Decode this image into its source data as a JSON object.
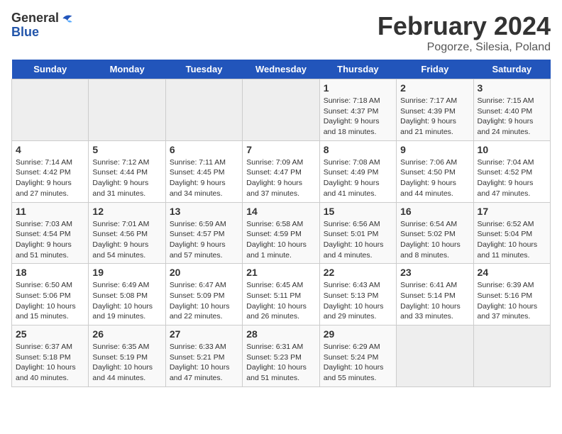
{
  "logo": {
    "general": "General",
    "blue": "Blue"
  },
  "title": {
    "main": "February 2024",
    "sub": "Pogorze, Silesia, Poland"
  },
  "weekdays": [
    "Sunday",
    "Monday",
    "Tuesday",
    "Wednesday",
    "Thursday",
    "Friday",
    "Saturday"
  ],
  "weeks": [
    [
      {
        "day": null,
        "info": null
      },
      {
        "day": null,
        "info": null
      },
      {
        "day": null,
        "info": null
      },
      {
        "day": null,
        "info": null
      },
      {
        "day": "1",
        "info": "Sunrise: 7:18 AM\nSunset: 4:37 PM\nDaylight: 9 hours\nand 18 minutes."
      },
      {
        "day": "2",
        "info": "Sunrise: 7:17 AM\nSunset: 4:39 PM\nDaylight: 9 hours\nand 21 minutes."
      },
      {
        "day": "3",
        "info": "Sunrise: 7:15 AM\nSunset: 4:40 PM\nDaylight: 9 hours\nand 24 minutes."
      }
    ],
    [
      {
        "day": "4",
        "info": "Sunrise: 7:14 AM\nSunset: 4:42 PM\nDaylight: 9 hours\nand 27 minutes."
      },
      {
        "day": "5",
        "info": "Sunrise: 7:12 AM\nSunset: 4:44 PM\nDaylight: 9 hours\nand 31 minutes."
      },
      {
        "day": "6",
        "info": "Sunrise: 7:11 AM\nSunset: 4:45 PM\nDaylight: 9 hours\nand 34 minutes."
      },
      {
        "day": "7",
        "info": "Sunrise: 7:09 AM\nSunset: 4:47 PM\nDaylight: 9 hours\nand 37 minutes."
      },
      {
        "day": "8",
        "info": "Sunrise: 7:08 AM\nSunset: 4:49 PM\nDaylight: 9 hours\nand 41 minutes."
      },
      {
        "day": "9",
        "info": "Sunrise: 7:06 AM\nSunset: 4:50 PM\nDaylight: 9 hours\nand 44 minutes."
      },
      {
        "day": "10",
        "info": "Sunrise: 7:04 AM\nSunset: 4:52 PM\nDaylight: 9 hours\nand 47 minutes."
      }
    ],
    [
      {
        "day": "11",
        "info": "Sunrise: 7:03 AM\nSunset: 4:54 PM\nDaylight: 9 hours\nand 51 minutes."
      },
      {
        "day": "12",
        "info": "Sunrise: 7:01 AM\nSunset: 4:56 PM\nDaylight: 9 hours\nand 54 minutes."
      },
      {
        "day": "13",
        "info": "Sunrise: 6:59 AM\nSunset: 4:57 PM\nDaylight: 9 hours\nand 57 minutes."
      },
      {
        "day": "14",
        "info": "Sunrise: 6:58 AM\nSunset: 4:59 PM\nDaylight: 10 hours\nand 1 minute."
      },
      {
        "day": "15",
        "info": "Sunrise: 6:56 AM\nSunset: 5:01 PM\nDaylight: 10 hours\nand 4 minutes."
      },
      {
        "day": "16",
        "info": "Sunrise: 6:54 AM\nSunset: 5:02 PM\nDaylight: 10 hours\nand 8 minutes."
      },
      {
        "day": "17",
        "info": "Sunrise: 6:52 AM\nSunset: 5:04 PM\nDaylight: 10 hours\nand 11 minutes."
      }
    ],
    [
      {
        "day": "18",
        "info": "Sunrise: 6:50 AM\nSunset: 5:06 PM\nDaylight: 10 hours\nand 15 minutes."
      },
      {
        "day": "19",
        "info": "Sunrise: 6:49 AM\nSunset: 5:08 PM\nDaylight: 10 hours\nand 19 minutes."
      },
      {
        "day": "20",
        "info": "Sunrise: 6:47 AM\nSunset: 5:09 PM\nDaylight: 10 hours\nand 22 minutes."
      },
      {
        "day": "21",
        "info": "Sunrise: 6:45 AM\nSunset: 5:11 PM\nDaylight: 10 hours\nand 26 minutes."
      },
      {
        "day": "22",
        "info": "Sunrise: 6:43 AM\nSunset: 5:13 PM\nDaylight: 10 hours\nand 29 minutes."
      },
      {
        "day": "23",
        "info": "Sunrise: 6:41 AM\nSunset: 5:14 PM\nDaylight: 10 hours\nand 33 minutes."
      },
      {
        "day": "24",
        "info": "Sunrise: 6:39 AM\nSunset: 5:16 PM\nDaylight: 10 hours\nand 37 minutes."
      }
    ],
    [
      {
        "day": "25",
        "info": "Sunrise: 6:37 AM\nSunset: 5:18 PM\nDaylight: 10 hours\nand 40 minutes."
      },
      {
        "day": "26",
        "info": "Sunrise: 6:35 AM\nSunset: 5:19 PM\nDaylight: 10 hours\nand 44 minutes."
      },
      {
        "day": "27",
        "info": "Sunrise: 6:33 AM\nSunset: 5:21 PM\nDaylight: 10 hours\nand 47 minutes."
      },
      {
        "day": "28",
        "info": "Sunrise: 6:31 AM\nSunset: 5:23 PM\nDaylight: 10 hours\nand 51 minutes."
      },
      {
        "day": "29",
        "info": "Sunrise: 6:29 AM\nSunset: 5:24 PM\nDaylight: 10 hours\nand 55 minutes."
      },
      {
        "day": null,
        "info": null
      },
      {
        "day": null,
        "info": null
      }
    ]
  ]
}
